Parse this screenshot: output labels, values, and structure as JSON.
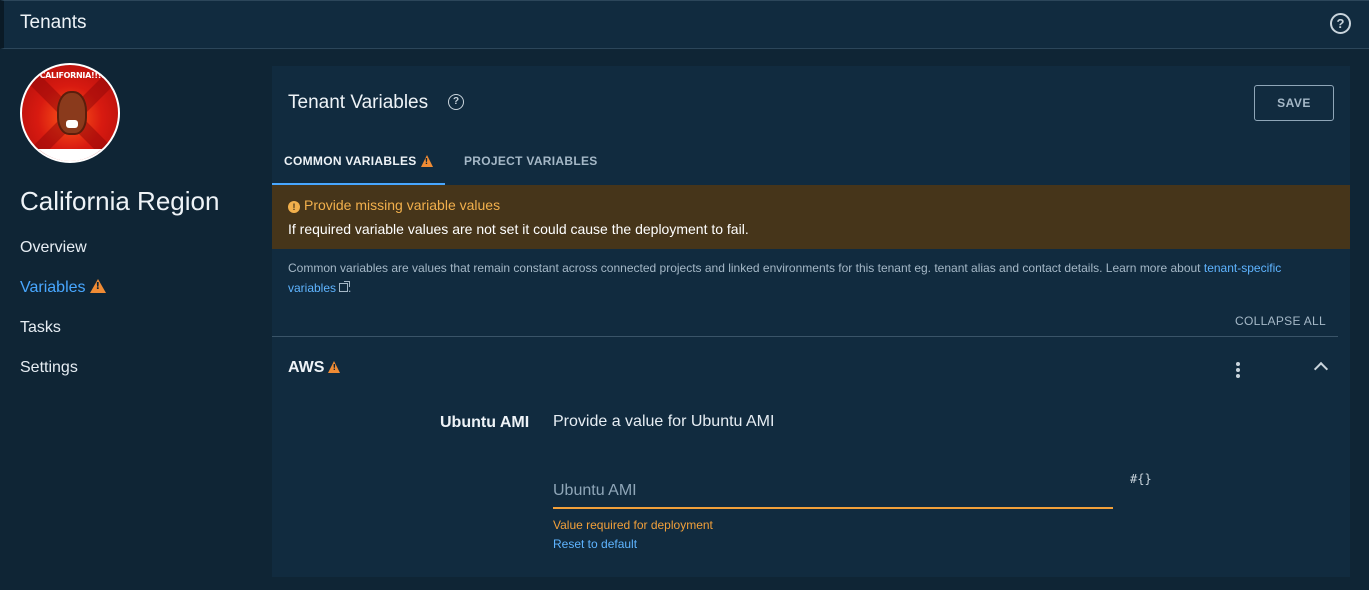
{
  "header": {
    "title": "Tenants",
    "help_icon": "help-circle-icon"
  },
  "sidebar": {
    "avatar_caption": "CALIFORNIA!!!!",
    "tenant_name": "California Region",
    "items": [
      {
        "label": "Overview",
        "active": false
      },
      {
        "label": "Variables",
        "active": true,
        "warning": true
      },
      {
        "label": "Tasks",
        "active": false
      },
      {
        "label": "Settings",
        "active": false
      }
    ]
  },
  "panel": {
    "title": "Tenant Variables",
    "save_label": "SAVE",
    "tabs": [
      {
        "label": "COMMON VARIABLES",
        "active": true,
        "warning": true
      },
      {
        "label": "PROJECT VARIABLES",
        "active": false
      }
    ],
    "alert": {
      "heading": "Provide missing variable values",
      "body": "If required variable values are not set it could cause the deployment to fail."
    },
    "description": {
      "text": "Common variables are values that remain constant across connected projects and linked environments for this tenant eg. tenant alias and contact details. Learn more about ",
      "link": "tenant-specific variables",
      "suffix": "."
    },
    "collapse_all": "COLLAPSE ALL",
    "group": {
      "title": "AWS",
      "variable": {
        "label": "Ubuntu AMI",
        "prompt": "Provide a value for Ubuntu AMI",
        "placeholder": "Ubuntu AMI",
        "value": "",
        "binding_icon": "#{}",
        "error": "Value required for deployment",
        "reset_label": "Reset to default"
      }
    }
  },
  "colors": {
    "accent": "#48a7ff",
    "warning": "#f08b34",
    "alert_bg": "#46351a",
    "panel_bg": "#112b3f"
  }
}
